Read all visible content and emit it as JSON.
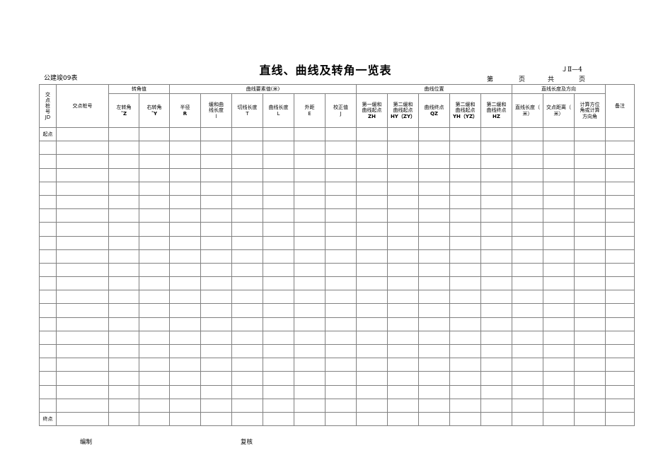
{
  "document": {
    "title": "直线、曲线及转角一览表",
    "form_code_left": "公建竣09表",
    "code_no": "ＪⅡ—4",
    "page_label_1": "第",
    "page_label_2": "页",
    "page_label_3": "共",
    "page_label_4": "页"
  },
  "table": {
    "groups": {
      "turn_angle": "转角值",
      "curve_elements": "曲线要素值(米)",
      "curve_position": "曲线位置",
      "line_length_direction": "直线长度及方向"
    },
    "columns": [
      {
        "key": "jd",
        "line1": "交",
        "line2": "点",
        "line3": "桩",
        "line4": "号",
        "line5": "JD"
      },
      {
        "key": "station",
        "label": "交点桩号"
      },
      {
        "key": "left_ang",
        "line1": "左转角",
        "line2": "Z"
      },
      {
        "key": "right_ang",
        "line1": "右转角",
        "line2": "Y"
      },
      {
        "key": "radius",
        "line1": "半径",
        "line2": "R"
      },
      {
        "key": "spiral_l",
        "line1": "缓和曲",
        "line2": "线长度",
        "line3": "l"
      },
      {
        "key": "tangent_t",
        "line1": "切线长度",
        "line2": "T"
      },
      {
        "key": "curve_l",
        "line1": "曲线长度",
        "line2": "L"
      },
      {
        "key": "external_e",
        "line1": "外距",
        "line2": "E"
      },
      {
        "key": "correct_j",
        "line1": "校正值",
        "line2": "J"
      },
      {
        "key": "zh",
        "line1": "第一缓和",
        "line2": "曲线起点",
        "line3": "ZH"
      },
      {
        "key": "hy",
        "line1": "第二缓和",
        "line2": "曲线起点",
        "line3": "HY（ZY）"
      },
      {
        "key": "qz",
        "line1": "曲线终点",
        "line2": "QZ"
      },
      {
        "key": "yh",
        "line1": "第二缓和",
        "line2": "曲线起点",
        "line3": "YH（YZ）"
      },
      {
        "key": "hz",
        "line1": "第二缓和",
        "line2": "曲线终点",
        "line3": "HZ"
      },
      {
        "key": "line_len",
        "line1": "直线长度（",
        "line2": "米）"
      },
      {
        "key": "jd_dist",
        "line1": "交点距离（",
        "line2": "米）"
      },
      {
        "key": "azimuth",
        "line1": "计算方位",
        "line2": "角或计算",
        "line3": "方向角"
      },
      {
        "key": "remark",
        "label": "备注"
      }
    ],
    "rows": [
      {
        "label": "起点"
      },
      {
        "label": ""
      },
      {
        "label": ""
      },
      {
        "label": ""
      },
      {
        "label": ""
      },
      {
        "label": ""
      },
      {
        "label": ""
      },
      {
        "label": ""
      },
      {
        "label": ""
      },
      {
        "label": ""
      },
      {
        "label": ""
      },
      {
        "label": ""
      },
      {
        "label": ""
      },
      {
        "label": ""
      },
      {
        "label": ""
      },
      {
        "label": ""
      },
      {
        "label": ""
      },
      {
        "label": ""
      },
      {
        "label": ""
      },
      {
        "label": ""
      },
      {
        "label": ""
      },
      {
        "label": "终点"
      }
    ]
  },
  "footer": {
    "prepared_by": "编制",
    "reviewed_by": "复核"
  }
}
